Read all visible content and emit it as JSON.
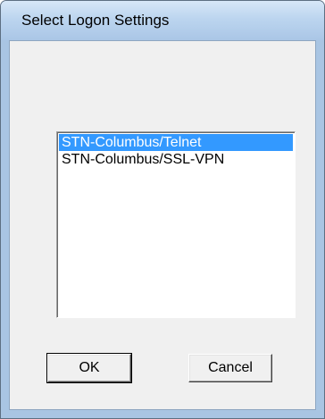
{
  "window": {
    "title": "Select Logon Settings"
  },
  "listbox": {
    "items": [
      {
        "label": "STN-Columbus/Telnet",
        "selected": true
      },
      {
        "label": "STN-Columbus/SSL-VPN",
        "selected": false
      }
    ]
  },
  "buttons": {
    "ok_label": "OK",
    "cancel_label": "Cancel"
  },
  "colors": {
    "selection": "#3399ff",
    "titlebar": "#bcd5ef",
    "dialog_background": "#f0f0f0"
  }
}
